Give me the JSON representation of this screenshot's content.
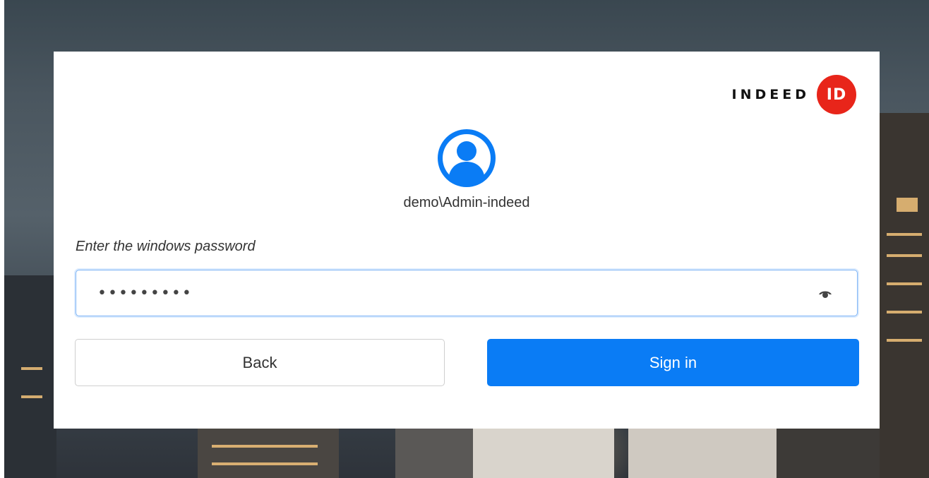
{
  "logo": {
    "text": "INDEED",
    "badge": "ID",
    "badge_color": "#e8251a"
  },
  "user": {
    "avatar_icon": "user-avatar-icon",
    "name": "demo\\Admin-indeed"
  },
  "form": {
    "prompt": "Enter the windows password",
    "password_value": "•••••••••",
    "show_password_icon": "eye-icon"
  },
  "buttons": {
    "back_label": "Back",
    "signin_label": "Sign in"
  },
  "colors": {
    "accent": "#0a7cf5",
    "brand": "#e8251a"
  }
}
